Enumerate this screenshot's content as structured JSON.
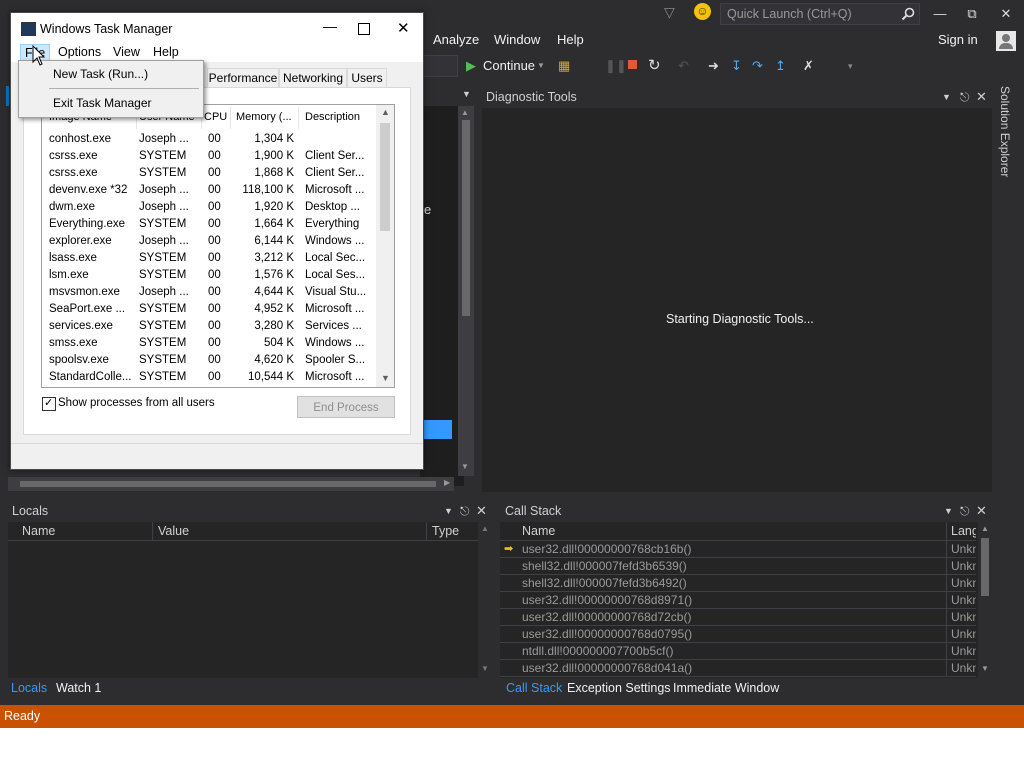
{
  "vs": {
    "quick_launch_placeholder": "Quick Launch (Ctrl+Q)",
    "menu": [
      "Analyze",
      "Window",
      "Help"
    ],
    "sign_in": "Sign in",
    "continue_label": "Continue",
    "diagnostic_tools": {
      "title": "Diagnostic Tools",
      "status": "Starting Diagnostic Tools..."
    },
    "solution_explorer": "Solution Explorer",
    "editor_fragment": "e",
    "locals": {
      "title": "Locals",
      "columns": [
        "Name",
        "Value",
        "Type"
      ],
      "tabs": [
        "Locals",
        "Watch 1"
      ]
    },
    "call_stack": {
      "title": "Call Stack",
      "columns": [
        "Name",
        "Lang"
      ],
      "rows": [
        {
          "name": "user32.dll!00000000768cb16b()",
          "lang": "Unkn"
        },
        {
          "name": "shell32.dll!000007fefd3b6539()",
          "lang": "Unkn"
        },
        {
          "name": "shell32.dll!000007fefd3b6492()",
          "lang": "Unkn"
        },
        {
          "name": "user32.dll!00000000768d8971()",
          "lang": "Unkn"
        },
        {
          "name": "user32.dll!00000000768d72cb()",
          "lang": "Unkn"
        },
        {
          "name": "user32.dll!00000000768d0795()",
          "lang": "Unkn"
        },
        {
          "name": "ntdll.dll!000000007700b5cf()",
          "lang": "Unkn"
        },
        {
          "name": "user32.dll!00000000768d041a()",
          "lang": "Unkn"
        }
      ],
      "tabs": [
        "Call Stack",
        "Exception Settings",
        "Immediate Window"
      ]
    },
    "status": "Ready",
    "colors": {
      "status_bar": "#ca5100",
      "accent": "#007acc",
      "background": "#2d2d30"
    }
  },
  "task_manager": {
    "title": "Windows Task Manager",
    "menu": [
      "File",
      "Options",
      "View",
      "Help"
    ],
    "file_menu_items": [
      "New Task (Run...)",
      "Exit Task Manager"
    ],
    "tabs": [
      "Performance",
      "Networking",
      "Users"
    ],
    "columns": [
      "Image Name",
      "User Name",
      "CPU",
      "Memory (...",
      "Description"
    ],
    "processes": [
      [
        "conhost.exe",
        "Joseph ...",
        "00",
        "1,304 K",
        ""
      ],
      [
        "csrss.exe",
        "SYSTEM",
        "00",
        "1,900 K",
        "Client Ser..."
      ],
      [
        "csrss.exe",
        "SYSTEM",
        "00",
        "1,868 K",
        "Client Ser..."
      ],
      [
        "devenv.exe *32",
        "Joseph ...",
        "00",
        "118,100 K",
        "Microsoft ..."
      ],
      [
        "dwm.exe",
        "Joseph ...",
        "00",
        "1,920 K",
        "Desktop ..."
      ],
      [
        "Everything.exe",
        "SYSTEM",
        "00",
        "1,664 K",
        "Everything"
      ],
      [
        "explorer.exe",
        "Joseph ...",
        "00",
        "6,144 K",
        "Windows ..."
      ],
      [
        "lsass.exe",
        "SYSTEM",
        "00",
        "3,212 K",
        "Local Sec..."
      ],
      [
        "lsm.exe",
        "SYSTEM",
        "00",
        "1,576 K",
        "Local Ses..."
      ],
      [
        "msvsmon.exe",
        "Joseph ...",
        "00",
        "4,644 K",
        "Visual Stu..."
      ],
      [
        "SeaPort.exe ...",
        "SYSTEM",
        "00",
        "4,952 K",
        "Microsoft ..."
      ],
      [
        "services.exe",
        "SYSTEM",
        "00",
        "3,280 K",
        "Services ..."
      ],
      [
        "smss.exe",
        "SYSTEM",
        "00",
        "504 K",
        "Windows ..."
      ],
      [
        "spoolsv.exe",
        "SYSTEM",
        "00",
        "4,620 K",
        "Spooler S..."
      ],
      [
        "StandardColle...",
        "SYSTEM",
        "00",
        "10,544 K",
        "Microsoft ..."
      ]
    ],
    "show_all_label": "Show processes from all users",
    "show_all_checked": true,
    "end_process": "End Process"
  }
}
